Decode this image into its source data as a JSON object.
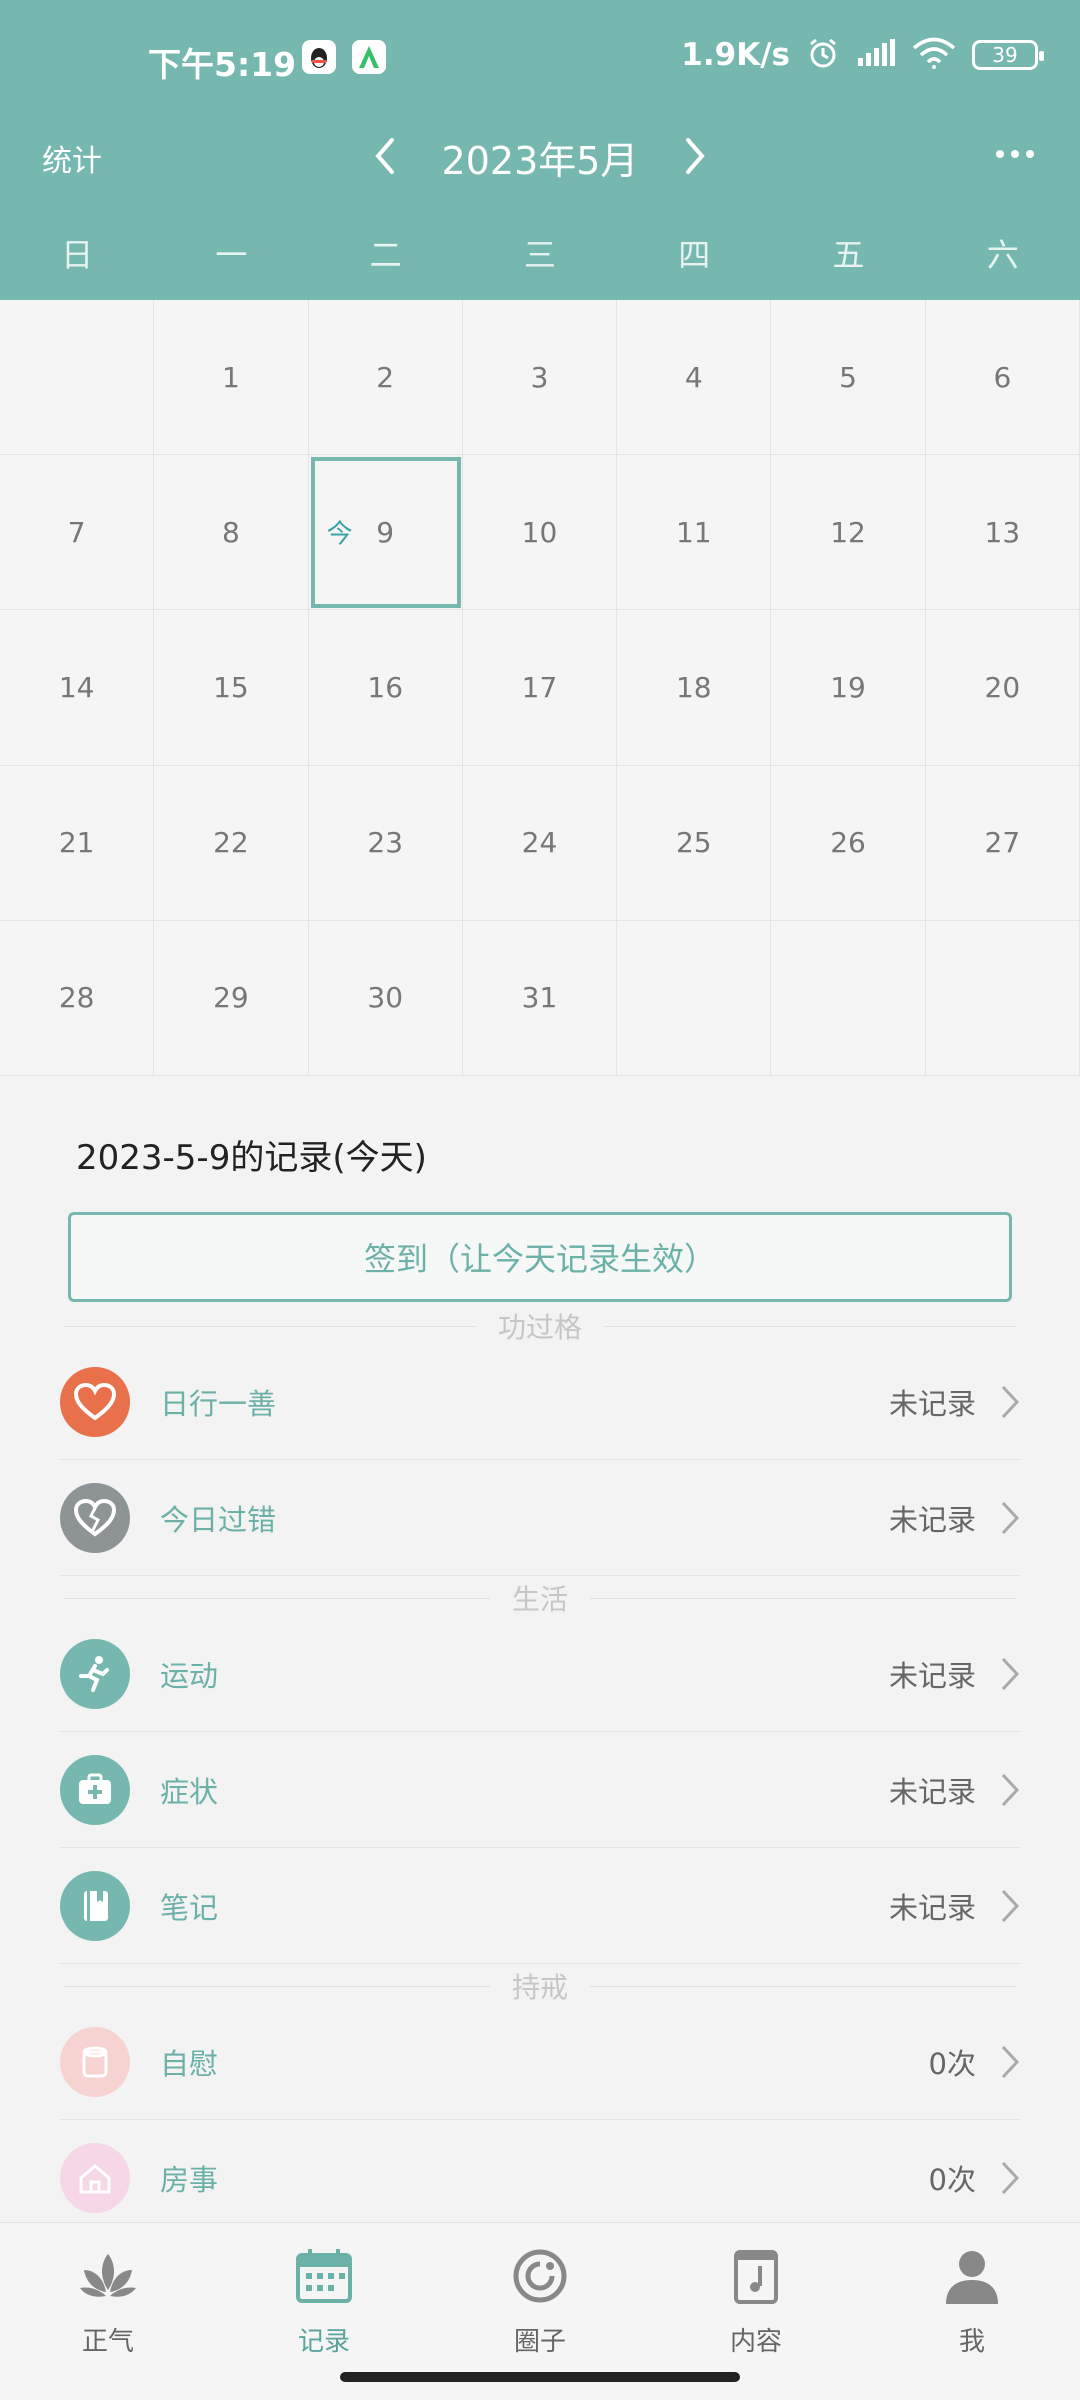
{
  "status_bar": {
    "time": "下午5:19",
    "net_speed": "1.9K/s",
    "battery": "39"
  },
  "header": {
    "stats_label": "统计",
    "month_title": "2023年5月",
    "weekdays": [
      "日",
      "一",
      "二",
      "三",
      "四",
      "五",
      "六"
    ]
  },
  "calendar": {
    "today_mark": "今",
    "weeks": [
      [
        "",
        "1",
        "2",
        "3",
        "4",
        "5",
        "6"
      ],
      [
        "7",
        "8",
        "9",
        "10",
        "11",
        "12",
        "13"
      ],
      [
        "14",
        "15",
        "16",
        "17",
        "18",
        "19",
        "20"
      ],
      [
        "21",
        "22",
        "23",
        "24",
        "25",
        "26",
        "27"
      ],
      [
        "28",
        "29",
        "30",
        "31",
        "",
        "",
        ""
      ]
    ],
    "today": "9"
  },
  "records": {
    "title": "2023-5-9的记录(今天)",
    "signin_label": "签到（让今天记录生效）",
    "sections": [
      {
        "name": "功过格",
        "items": [
          {
            "label": "日行一善",
            "value": "未记录",
            "icon": "heart-icon",
            "color": "#e8704a"
          },
          {
            "label": "今日过错",
            "value": "未记录",
            "icon": "broken-heart-icon",
            "color": "#8e9396"
          }
        ]
      },
      {
        "name": "生活",
        "items": [
          {
            "label": "运动",
            "value": "未记录",
            "icon": "running-icon",
            "color": "#76b8b0"
          },
          {
            "label": "症状",
            "value": "未记录",
            "icon": "medkit-icon",
            "color": "#76b8b0"
          },
          {
            "label": "笔记",
            "value": "未记录",
            "icon": "notebook-icon",
            "color": "#76b8b0"
          }
        ]
      },
      {
        "name": "持戒",
        "items": [
          {
            "label": "自慰",
            "value": "0次",
            "icon": "tissue-icon",
            "color": "#f6d3d0"
          },
          {
            "label": "房事",
            "value": "0次",
            "icon": "house-icon",
            "color": "#f6d7e7"
          }
        ]
      }
    ]
  },
  "tabbar": {
    "items": [
      {
        "label": "正气",
        "icon": "lotus-icon",
        "active": false
      },
      {
        "label": "记录",
        "icon": "calendar-icon",
        "active": true
      },
      {
        "label": "圈子",
        "icon": "circle-icon",
        "active": false
      },
      {
        "label": "内容",
        "icon": "music-book-icon",
        "active": false
      },
      {
        "label": "我",
        "icon": "person-icon",
        "active": false
      }
    ]
  },
  "colors": {
    "accent": "#76b8b0",
    "accent_text": "#6bb1a8",
    "today_mark": "#3aa3a6"
  }
}
